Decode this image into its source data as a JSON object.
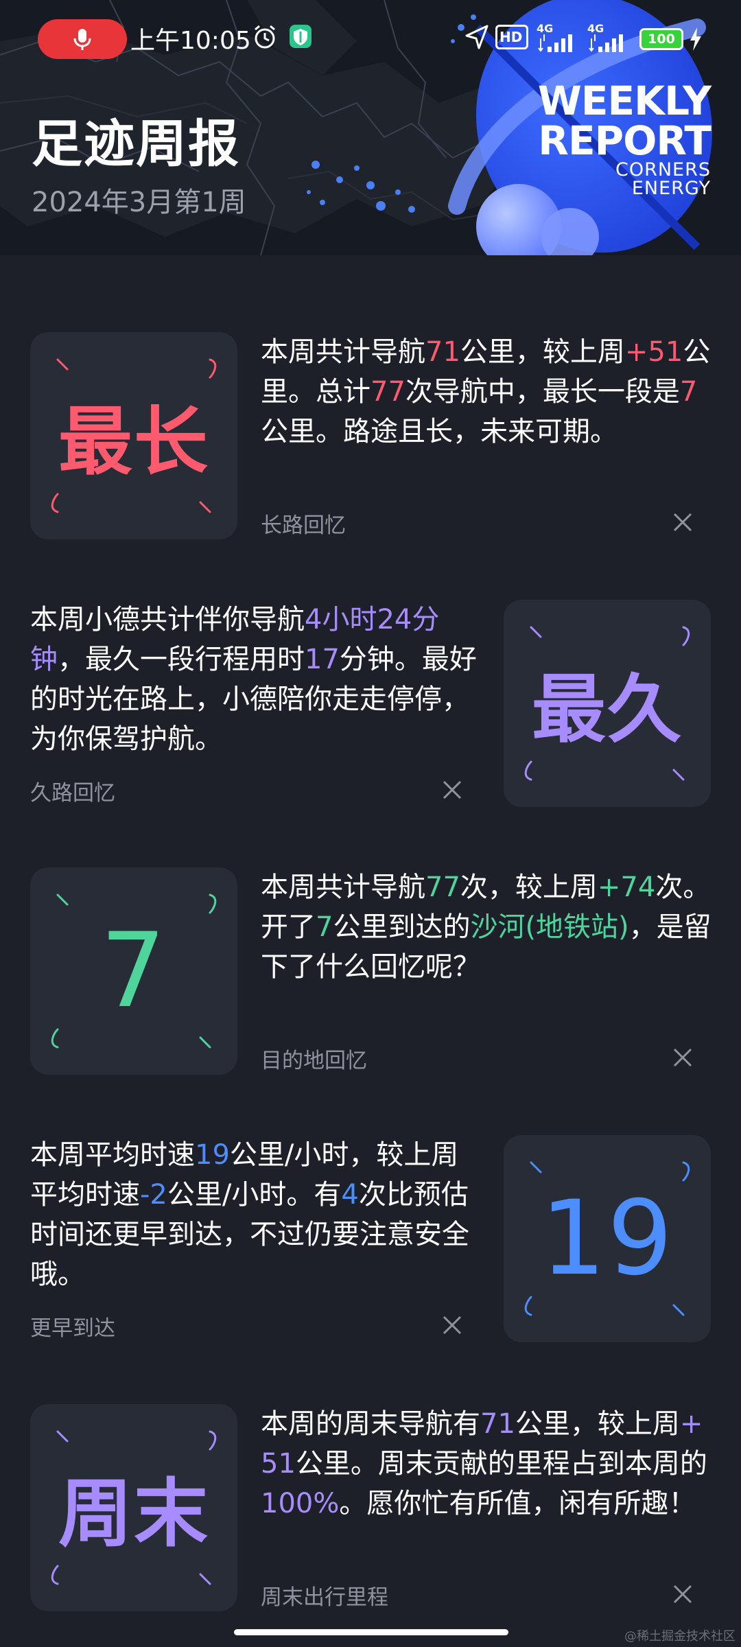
{
  "status_bar": {
    "time": "上午10:05",
    "battery": "100",
    "network_1": "4G",
    "network_2": "4G",
    "hd": "HD"
  },
  "header": {
    "title": "足迹周报",
    "subtitle": "2024年3月第1周",
    "badge": {
      "line1": "WEEKLY",
      "line2": "REPORT",
      "line3": "CORNERS",
      "line4": "ENERGY"
    }
  },
  "cards": [
    {
      "tile_text": "最长",
      "label": "长路回忆",
      "accent": "#ff5a6e",
      "desc": {
        "p1": "本周共计导航",
        "v1": "71",
        "p2": "公里，较上周",
        "v2": "+51",
        "p3": "公里。总计",
        "v3": "77",
        "p4": "次导航中，最长一段是",
        "v4": "7",
        "p5": "公里。路途且长，未来可期。"
      }
    },
    {
      "tile_text": "最久",
      "label": "久路回忆",
      "accent": "#a78cff",
      "desc": {
        "p1": "本周小德共计伴你导航",
        "v1": "4小时24分钟",
        "p2": "，最久一段行程用时",
        "v2": "17",
        "p3": "分钟。最好的时光在路上，小德陪你走走停停，为你保驾护航。"
      }
    },
    {
      "tile_text": "7",
      "label": "目的地回忆",
      "accent": "#4fd59b",
      "desc": {
        "p1": "本周共计导航",
        "v1": "77",
        "p2": "次，较上周",
        "v2": "+74",
        "p3": "次。开了",
        "v3": "7",
        "p4": "公里到达的",
        "v4": "沙河(地铁站)",
        "p5": "，是留下了什么回忆呢？"
      }
    },
    {
      "tile_text": "19",
      "label": "更早到达",
      "accent": "#4c8dff",
      "desc": {
        "p1": "本周平均时速",
        "v1": "19",
        "p2": "公里/小时，较上周平均时速",
        "v2": "-2",
        "p3": "公里/小时。有",
        "v3": "4",
        "p4": "次比预估时间还更早到达，不过仍要注意安全哦。"
      }
    },
    {
      "tile_text": "周末",
      "label": "周末出行里程",
      "accent": "#a78cff",
      "desc": {
        "p1": "本周的周末导航有",
        "v1": "71",
        "p2": "公里，较上周",
        "v2": "+51",
        "p3": "公里。周末贡献的里程占到本周的",
        "v3": "100%",
        "p4": "。愿你忙有所值，闲有所趣！"
      }
    }
  ],
  "watermark": "@稀土掘金技术社区",
  "icons": {
    "mic": "mic-icon",
    "alarm": "alarm-icon",
    "shield": "shield-icon",
    "location": "location-arrow-icon",
    "signal": "signal-icon",
    "charging": "charging-icon",
    "close": "close-icon"
  }
}
